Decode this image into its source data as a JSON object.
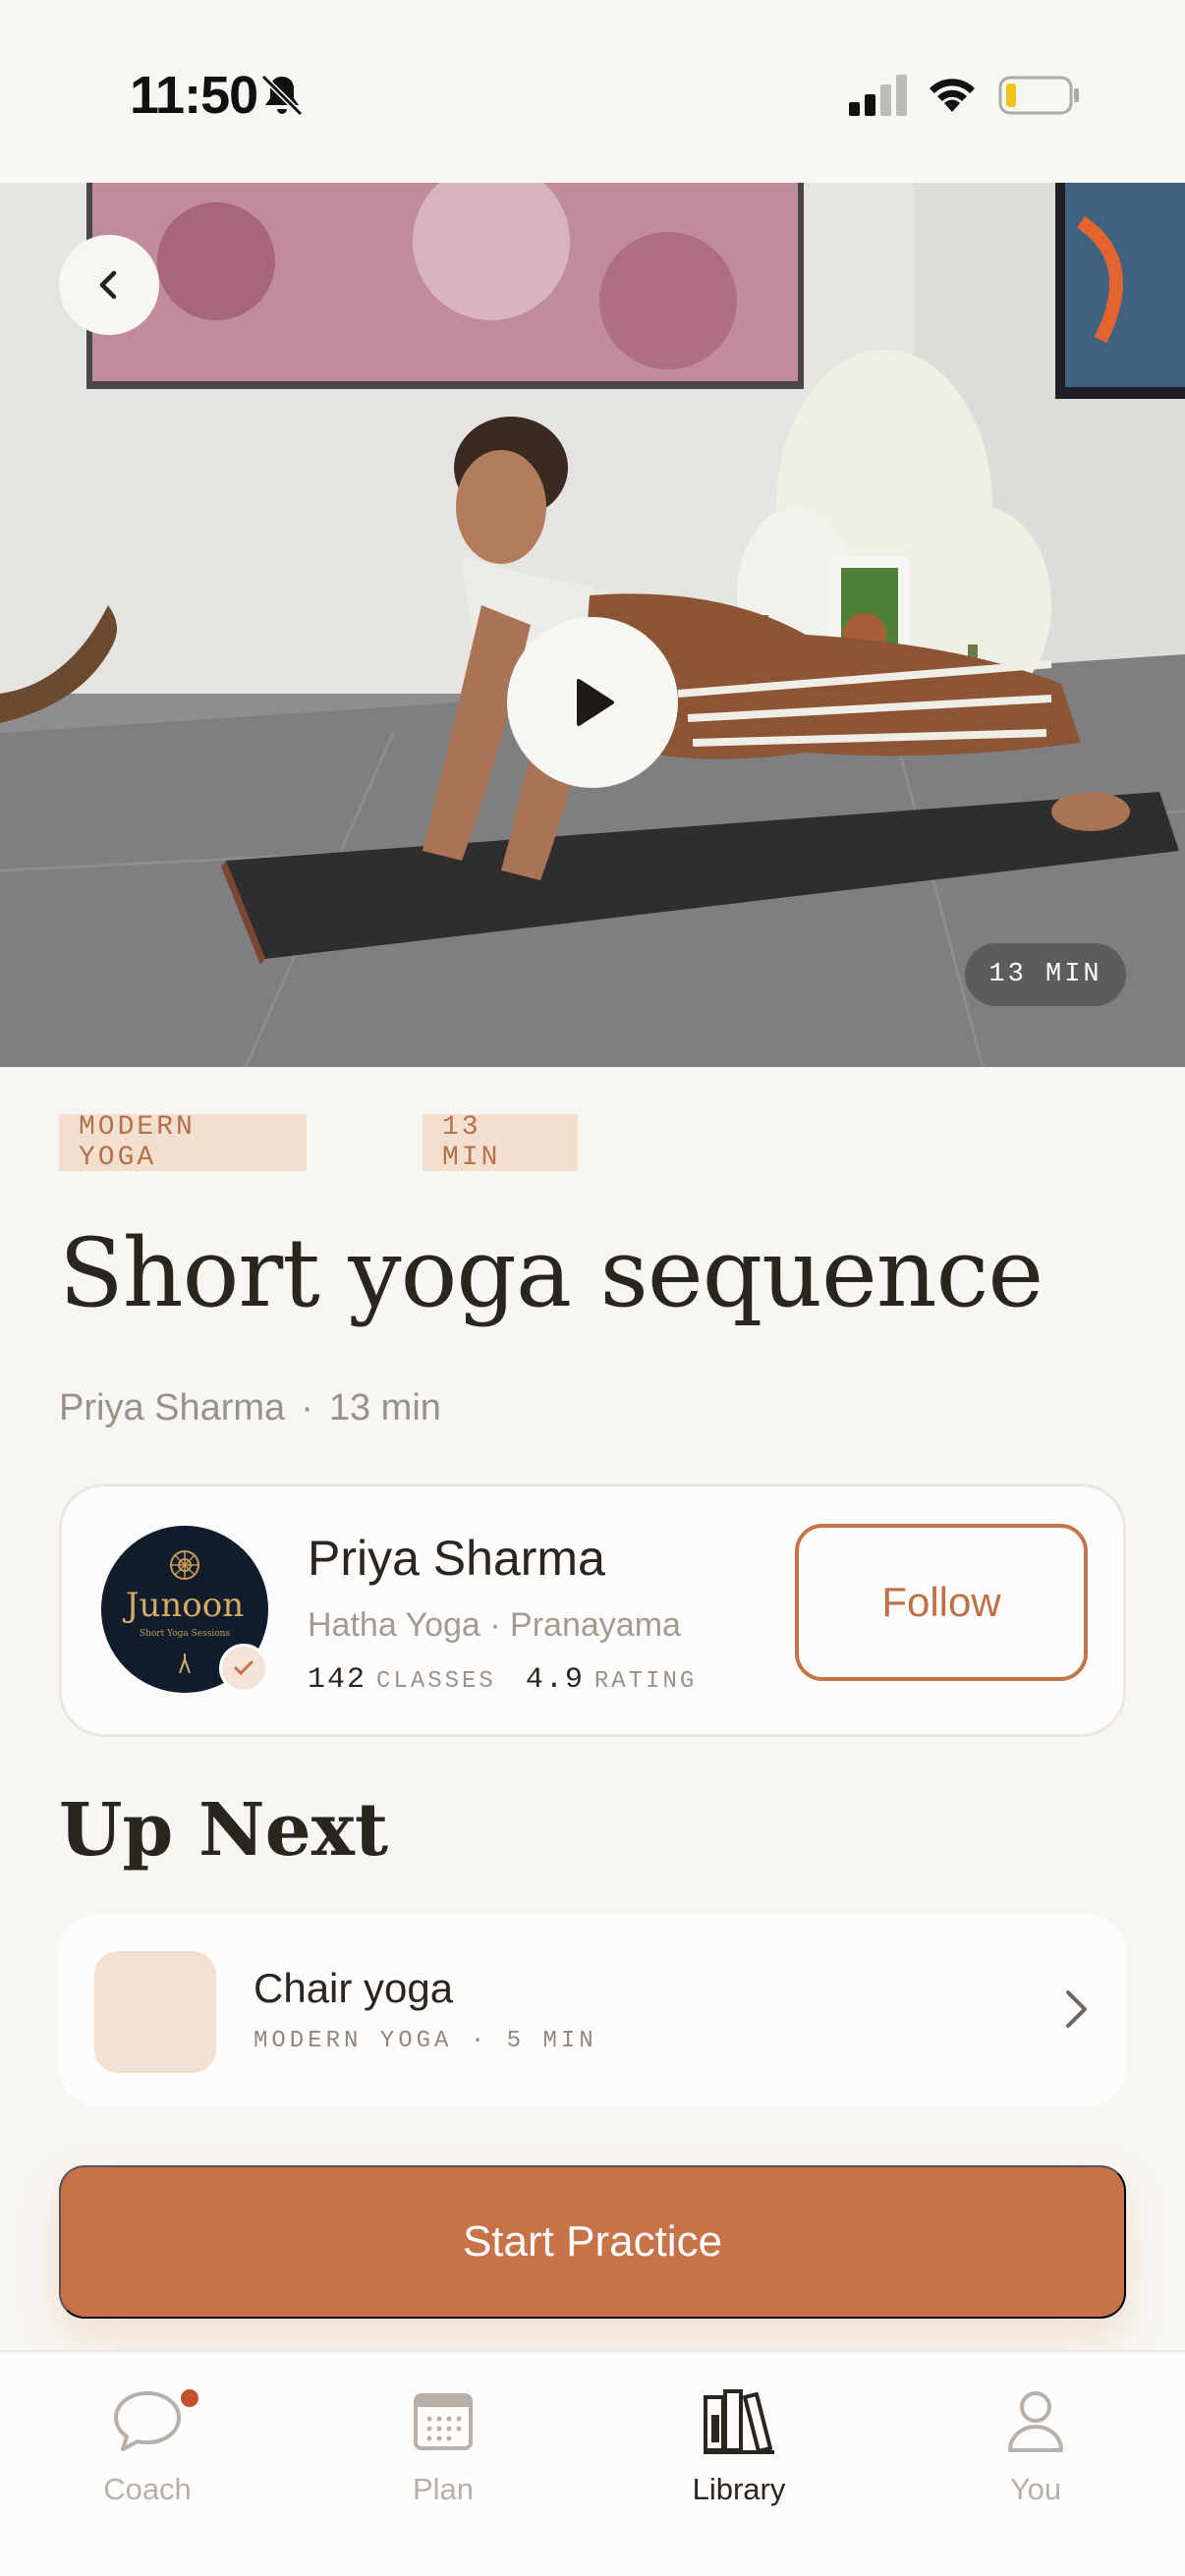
{
  "status_bar": {
    "time": "11:50",
    "icons": [
      "bell-slash-icon",
      "signal-icon",
      "wifi-icon",
      "battery-low-icon"
    ]
  },
  "hero": {
    "back_icon": "chevron-left-icon",
    "play_icon": "play-icon",
    "duration_badge": "13 MIN"
  },
  "tags": [
    "MODERN YOGA",
    "13 MIN"
  ],
  "title": "Short yoga sequence",
  "meta": {
    "instructor": "Priya Sharma",
    "separator": "·",
    "duration": "13 min"
  },
  "instructor_card": {
    "name": "Priya Sharma",
    "styles": "Hatha Yoga · Pranayama",
    "classes_count": "142",
    "classes_label": "CLASSES",
    "rating_value": "4.9",
    "rating_label": "RATING",
    "follow_label": "Follow",
    "avatar_logo_text": "Junoon",
    "avatar_logo_subtext": "Short Yoga Sessions",
    "verified_icon": "check-icon"
  },
  "up_next": {
    "heading": "Up Next",
    "item": {
      "title": "Chair yoga",
      "meta": "MODERN YOGA · 5 MIN",
      "icon": "chevron-right-icon"
    }
  },
  "start_button": "Start Practice",
  "tab_bar": {
    "tabs": [
      {
        "label": "Coach",
        "icon": "chat-bubble-icon",
        "active": false,
        "badge": true
      },
      {
        "label": "Plan",
        "icon": "calendar-icon",
        "active": false
      },
      {
        "label": "Library",
        "icon": "library-books-icon",
        "active": true
      },
      {
        "label": "You",
        "icon": "person-icon",
        "active": false
      }
    ]
  },
  "colors": {
    "accent": "#c77249",
    "background": "#f8f6f2",
    "tag_bg": "#f2dfcf",
    "tag_text": "#b5714b",
    "text_primary": "#2b2520",
    "text_muted": "#9a918a"
  }
}
